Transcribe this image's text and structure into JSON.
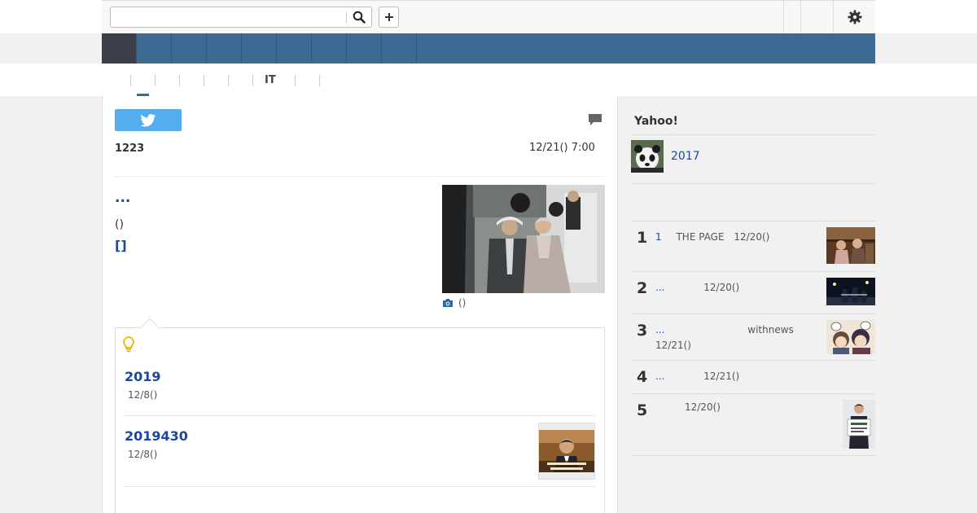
{
  "search": {
    "value": "",
    "placeholder": ""
  },
  "icons": {
    "search": "search-icon",
    "plus": "plus-icon",
    "settings": "gear-icon",
    "twitter": "twitter-bird-icon",
    "comment": "comment-bubble-icon",
    "camera": "camera-icon",
    "lightbulb": "lightbulb-icon"
  },
  "nav": {
    "items": [
      "",
      "",
      "",
      "",
      "",
      "",
      "",
      "",
      ""
    ]
  },
  "category_tabs": [
    "",
    "",
    "",
    "",
    "",
    "IT",
    ""
  ],
  "article": {
    "byline": "1223",
    "date": "12/21() 7:00",
    "headline": "...",
    "paren": "()",
    "brackets": "[]",
    "photo_caption": "()"
  },
  "related": [
    {
      "title": "2019",
      "date": "12/8()"
    },
    {
      "title": "2019430",
      "date": "12/8()"
    }
  ],
  "sidebar": {
    "title": "Yahoo!",
    "feature": "2017",
    "ranking": [
      {
        "num": "1",
        "link": "1",
        "source": "THE PAGE",
        "date": "12/20()"
      },
      {
        "num": "2",
        "link": "...",
        "source": "",
        "date": "12/20()"
      },
      {
        "num": "3",
        "link": "...",
        "source": "withnews",
        "date": "12/21()"
      },
      {
        "num": "4",
        "link": "...",
        "source": "",
        "date": "12/21()"
      },
      {
        "num": "5",
        "link": "",
        "source": "",
        "date": "12/20()"
      }
    ]
  },
  "colors": {
    "nav_bar": "#3d6a93",
    "nav_active": "#3b3f4a",
    "link": "#1a47a3",
    "twitter": "#55acee",
    "background": "#f1f1f1"
  }
}
